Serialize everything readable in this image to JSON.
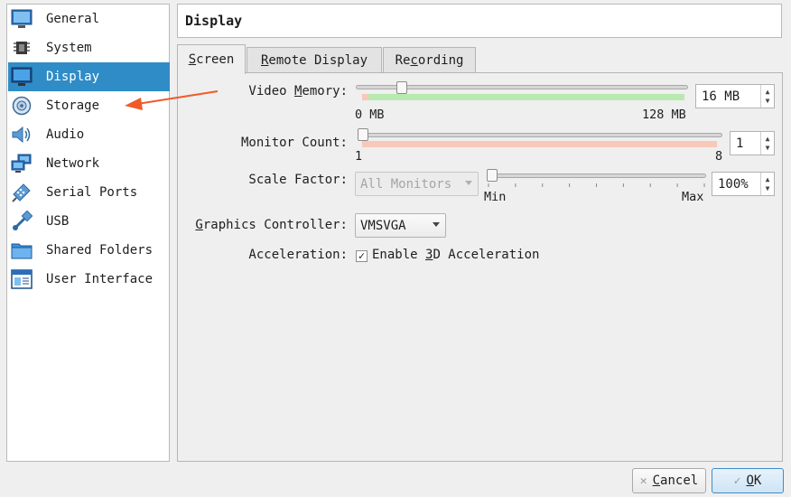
{
  "sidebar": {
    "items": [
      {
        "label": "General",
        "icon": "general-icon"
      },
      {
        "label": "System",
        "icon": "system-icon"
      },
      {
        "label": "Display",
        "icon": "display-icon",
        "selected": true
      },
      {
        "label": "Storage",
        "icon": "storage-icon"
      },
      {
        "label": "Audio",
        "icon": "audio-icon"
      },
      {
        "label": "Network",
        "icon": "network-icon"
      },
      {
        "label": "Serial Ports",
        "icon": "serial-ports-icon"
      },
      {
        "label": "USB",
        "icon": "usb-icon"
      },
      {
        "label": "Shared Folders",
        "icon": "shared-folders-icon"
      },
      {
        "label": "User Interface",
        "icon": "user-interface-icon"
      }
    ]
  },
  "header": {
    "title": "Display"
  },
  "tabs": [
    {
      "pre": "",
      "mnemonic": "S",
      "post": "creen",
      "active": true
    },
    {
      "pre": "",
      "mnemonic": "R",
      "post": "emote Display",
      "active": false
    },
    {
      "pre": "Re",
      "mnemonic": "c",
      "post": "ording",
      "active": false
    }
  ],
  "screen": {
    "video_memory": {
      "label_pre": "Video ",
      "label_mnemonic": "M",
      "label_post": "emory:",
      "value": "16 MB",
      "min_label": "0 MB",
      "max_label": "128 MB",
      "level": 16,
      "max": 128
    },
    "monitor_count": {
      "label": "Monitor Count:",
      "value": "1",
      "min_label": "1",
      "max_label": "8",
      "level": 1,
      "max": 8
    },
    "scale_factor": {
      "label": "Scale Factor:",
      "combo_value": "All Monitors",
      "value": "100%",
      "min_label": "Min",
      "max_label": "Max",
      "level": 0
    },
    "graphics_controller": {
      "label_mnemonic": "G",
      "label_post": "raphics Controller:",
      "value": "VMSVGA"
    },
    "acceleration": {
      "label": "Acceleration:",
      "checked": true,
      "check_mark": "✓",
      "option_pre": "Enable ",
      "option_mnemonic": "3",
      "option_post": "D Acceleration"
    }
  },
  "buttons": {
    "cancel": {
      "mnemonic": "C",
      "post": "ancel",
      "icon": "cancel-icon"
    },
    "ok": {
      "pre": "",
      "mnemonic": "O",
      "post": "K",
      "icon": "ok-check-icon"
    }
  },
  "colors": {
    "selection": "#308cc6",
    "recommended_range": "#b8eab0",
    "warning_range": "#f8c8b8",
    "annotation_arrow": "#f05a28"
  }
}
